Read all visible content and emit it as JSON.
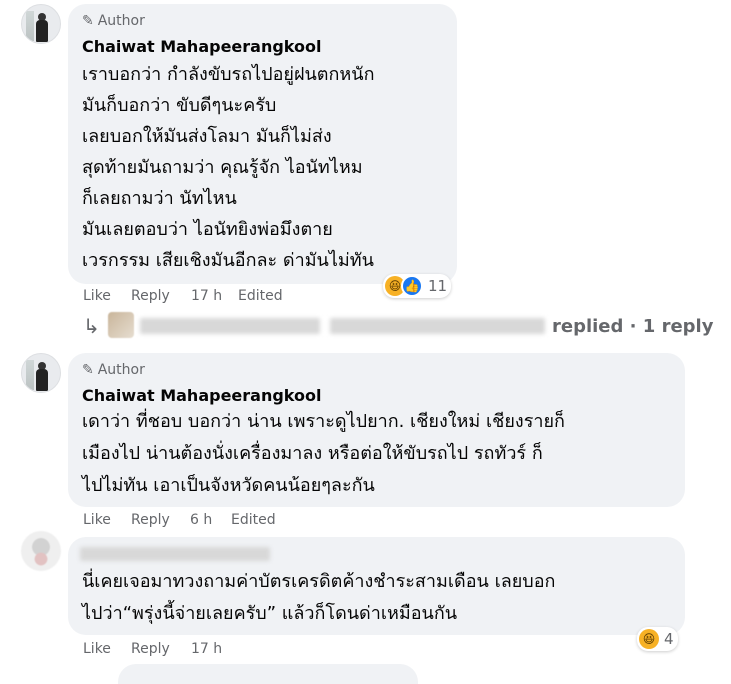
{
  "comments": [
    {
      "author_badge": "Author",
      "name": "Chaiwat Mahapeerangkool",
      "lines": [
        "เราบอกว่า กำลังขับรถไปอยู่ฝนตกหนัก",
        "มันก็บอกว่า ขับดีๆนะครับ",
        "เลยบอกให้มันส่งโลมา มันก็ไม่ส่ง",
        "สุดท้ายมันถามว่า คุณรู้จัก ไอนัทไหม",
        "ก็เลยถามว่า นัทไหน",
        "มันเลยตอบว่า ไอนัทยิงพ่อมึงตาย",
        "เวรกรรม เสียเชิงมันอีกละ ด่ามันไม่ทัน"
      ],
      "like": "Like",
      "reply": "Reply",
      "time": "17 h",
      "edited": "Edited",
      "reaction_count": "11"
    },
    {
      "author_badge": "Author",
      "name": "Chaiwat Mahapeerangkool",
      "lines": [
        "เดาว่า ที่ชอบ บอกว่า น่าน เพราะดูไปยาก. เชียงใหม่ เชียงรายก็",
        "เมืองไป น่านต้องนั่งเครื่องมาลง หรือต่อให้ขับรถไป รถทัวร์ ก็",
        "ไปไม่ทัน เอาเป็นจังหวัดคนน้อยๆละกัน"
      ],
      "like": "Like",
      "reply": "Reply",
      "time": "6 h",
      "edited": "Edited"
    },
    {
      "lines": [
        "นี่เคยเจอมาทวงถามค่าบัตรเครดิตค้างชำระสามเดือน เลยบอก",
        "ไปว่า“พรุ่งนี้จ่ายเลยครับ” แล้วก็โดนด่าเหมือนกัน"
      ],
      "like": "Like",
      "reply": "Reply",
      "time": "17 h",
      "reaction_count": "4"
    }
  ],
  "replied_summary": "replied · 1 reply",
  "icons": {
    "edit": "pencil-icon",
    "reply_arrow": "reply-arrow-icon",
    "haha": "haha-reaction-icon",
    "like": "like-reaction-icon"
  },
  "colors": {
    "bubble": "#f0f2f5",
    "secondary_text": "#65676b",
    "like_blue": "#1877f2",
    "haha_yellow": "#f7b125"
  }
}
